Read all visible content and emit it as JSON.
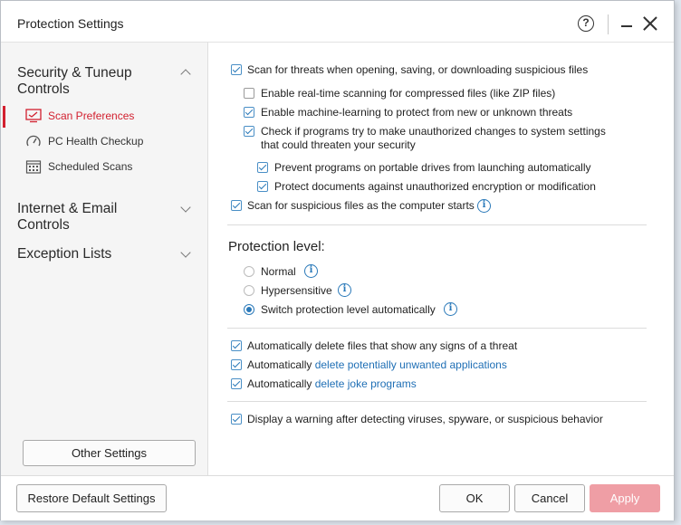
{
  "window": {
    "title": "Protection Settings"
  },
  "titlebar": {
    "help_glyph": "?"
  },
  "sidebar": {
    "groups": [
      {
        "label": "Security & Tuneup Controls",
        "expanded": true,
        "items": [
          {
            "label": "Scan Preferences",
            "icon": "monitor-icon",
            "active": true
          },
          {
            "label": "PC Health Checkup",
            "icon": "gauge-icon",
            "active": false
          },
          {
            "label": "Scheduled Scans",
            "icon": "calendar-icon",
            "active": false
          }
        ]
      },
      {
        "label": "Internet & Email Controls",
        "expanded": false
      },
      {
        "label": "Exception Lists",
        "expanded": false
      }
    ],
    "other_settings_label": "Other Settings"
  },
  "main": {
    "scan_options": [
      {
        "label": "Scan for threats when opening, saving, or downloading suspicious files",
        "checked": true
      },
      {
        "label": "Enable real-time scanning for compressed files (like ZIP files)",
        "checked": false
      },
      {
        "label": "Enable machine-learning to protect from new or unknown threats",
        "checked": true
      },
      {
        "label": "Check if programs try to make unauthorized changes to system settings that could threaten your security",
        "checked": true
      },
      {
        "label": "Prevent programs on portable drives from launching automatically",
        "checked": true
      },
      {
        "label": "Protect documents against unauthorized encryption or modification",
        "checked": true
      },
      {
        "label": "Scan for suspicious files as the computer starts",
        "checked": true
      }
    ],
    "protection_level": {
      "title": "Protection level:",
      "options": [
        {
          "label": "Normal",
          "selected": false
        },
        {
          "label": "Hypersensitive",
          "selected": false
        },
        {
          "label": "Switch protection level automatically",
          "selected": true
        }
      ]
    },
    "auto_delete": [
      {
        "label": "Automatically delete files that show any signs of a threat",
        "checked": true
      },
      {
        "prefix": "Automatically ",
        "link": "delete potentially unwanted applications",
        "checked": true
      },
      {
        "prefix": "Automatically ",
        "link": "delete joke programs",
        "checked": true
      }
    ],
    "warning": {
      "label": "Display a warning after detecting viruses, spyware, or suspicious behavior",
      "checked": true
    },
    "info_glyph": "i"
  },
  "footer": {
    "restore_label": "Restore Default Settings",
    "ok_label": "OK",
    "cancel_label": "Cancel",
    "apply_label": "Apply"
  },
  "colors": {
    "accent_red": "#d2202f",
    "link_blue": "#1f6fb5",
    "apply_disabled": "#ef9ea5"
  }
}
